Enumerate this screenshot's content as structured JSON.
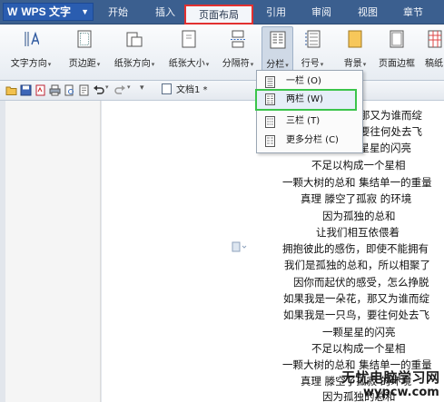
{
  "app": {
    "name": "WPS 文字"
  },
  "menu_tabs": [
    "开始",
    "插入",
    "页面布局",
    "引用",
    "审阅",
    "视图",
    "章节"
  ],
  "ribbon": {
    "buttons": [
      "文字方向",
      "页边距",
      "纸张方向",
      "纸张大小",
      "分隔符",
      "分栏",
      "行号",
      "背景",
      "页面边框",
      "稿纸"
    ]
  },
  "document": {
    "tab_title": "文档1 *"
  },
  "dropdown": {
    "items": [
      {
        "label": "一栏 (O)"
      },
      {
        "label": "两栏 (W)"
      },
      {
        "label": "三栏 (T)"
      },
      {
        "label": "更多分栏 (C)"
      }
    ]
  },
  "page_lines": [
    "那又为谁而绽",
    "要往何处去飞",
    "颗星星的闪亮",
    "不足以构成一个星相",
    "一颗大树的总和  集结单一的重量",
    "真理  滕空了孤寂  的环境",
    "因为孤独的总和",
    "让我们相互依偎着",
    "拥抱彼此的感伤，即使不能拥有",
    "我们是孤独的总和，所以相聚了",
    "因你而起伏的感受，怎么挣脱",
    "如果我是一朵花，那又为谁而绽",
    "如果我是一只鸟，要往何处去飞",
    "一颗星星的闪亮",
    "不足以构成一个星相",
    "一颗大树的总和  集结单一的重量",
    "真理  滕空了孤寂  的环境",
    "因为孤独的总和"
  ],
  "watermark": {
    "line1": "无忧电脑学习网",
    "line2": "wypcw.com"
  },
  "colors": {
    "titlebar": "#3b5f8f",
    "active_tab_box": "#e23030",
    "highlight_box": "#3bc44b"
  }
}
